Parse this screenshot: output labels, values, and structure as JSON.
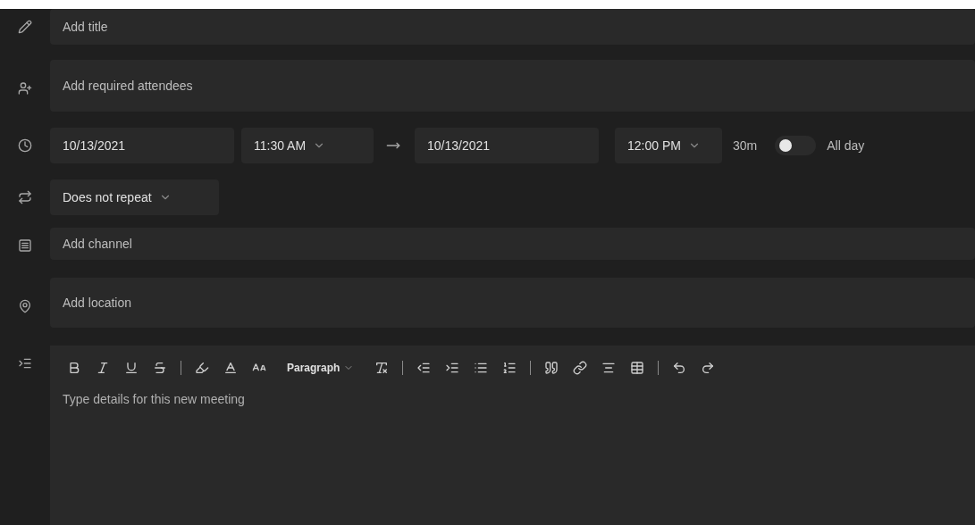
{
  "title_field": {
    "placeholder": "Add title"
  },
  "attendees_field": {
    "placeholder": "Add required attendees"
  },
  "schedule": {
    "start_date": "10/13/2021",
    "start_time": "11:30 AM",
    "end_date": "10/13/2021",
    "end_time": "12:00 PM",
    "duration": "30m",
    "all_day": {
      "label": "All day",
      "on": false
    }
  },
  "repeat": {
    "value": "Does not repeat"
  },
  "channel_field": {
    "placeholder": "Add channel"
  },
  "location_field": {
    "placeholder": "Add location"
  },
  "editor": {
    "style_menu": "Paragraph",
    "placeholder": "Type details for this new meeting"
  }
}
